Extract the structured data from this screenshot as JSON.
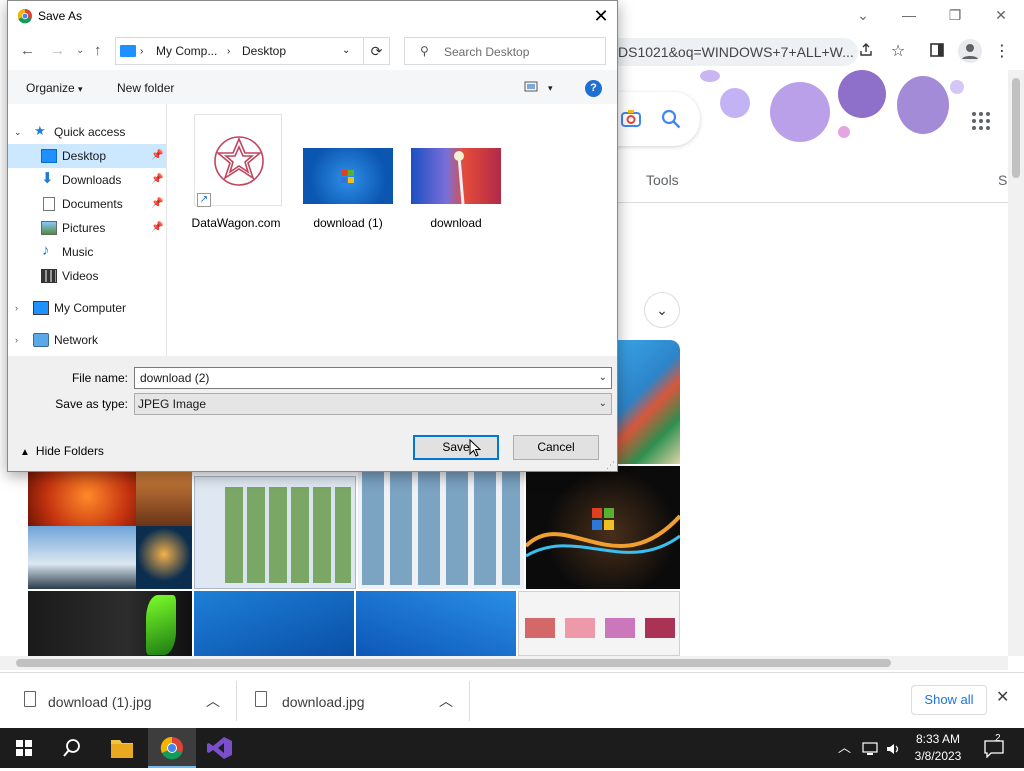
{
  "browser": {
    "url_fragment": "DS1021&oq=WINDOWS+7+ALL+W...",
    "tabs_label_tools": "Tools",
    "tabs_label_s": "S",
    "window_controls": [
      "chevron-down",
      "minimize",
      "restore",
      "close"
    ],
    "toolbar_icons": [
      "share-icon",
      "star-icon",
      "sidebar-icon",
      "profile-icon",
      "menu-icon"
    ]
  },
  "downloads": {
    "items": [
      {
        "name": "download (1).jpg"
      },
      {
        "name": "download.jpg"
      }
    ],
    "show_all": "Show all"
  },
  "dialog": {
    "title": "Save As",
    "breadcrumb": [
      "My Comp...",
      "Desktop"
    ],
    "search_placeholder": "Search Desktop",
    "commands": {
      "organize": "Organize",
      "new_folder": "New folder"
    },
    "nav": {
      "quick_access": "Quick access",
      "items": [
        {
          "label": "Desktop",
          "pinned": true,
          "selected": true
        },
        {
          "label": "Downloads",
          "pinned": true
        },
        {
          "label": "Documents",
          "pinned": true
        },
        {
          "label": "Pictures",
          "pinned": true
        },
        {
          "label": "Music"
        },
        {
          "label": "Videos"
        }
      ],
      "my_computer": "My Computer",
      "network": "Network"
    },
    "files": [
      {
        "label": "DataWagon.com"
      },
      {
        "label": "download (1)"
      },
      {
        "label": "download"
      }
    ],
    "file_name_label": "File name:",
    "file_name_value": "download (2)",
    "save_type_label": "Save as type:",
    "save_type_value": "JPEG Image",
    "hide_folders": "Hide Folders",
    "save_label": "Save",
    "cancel_label": "Cancel"
  },
  "taskbar": {
    "time": "8:33 AM",
    "date": "3/8/2023",
    "notifications": "2"
  },
  "colors": {
    "accent": "#0078d7",
    "selection": "#cce8ff",
    "link_blue": "#1a73e8",
    "taskbar_bg": "#1c1c1c"
  }
}
